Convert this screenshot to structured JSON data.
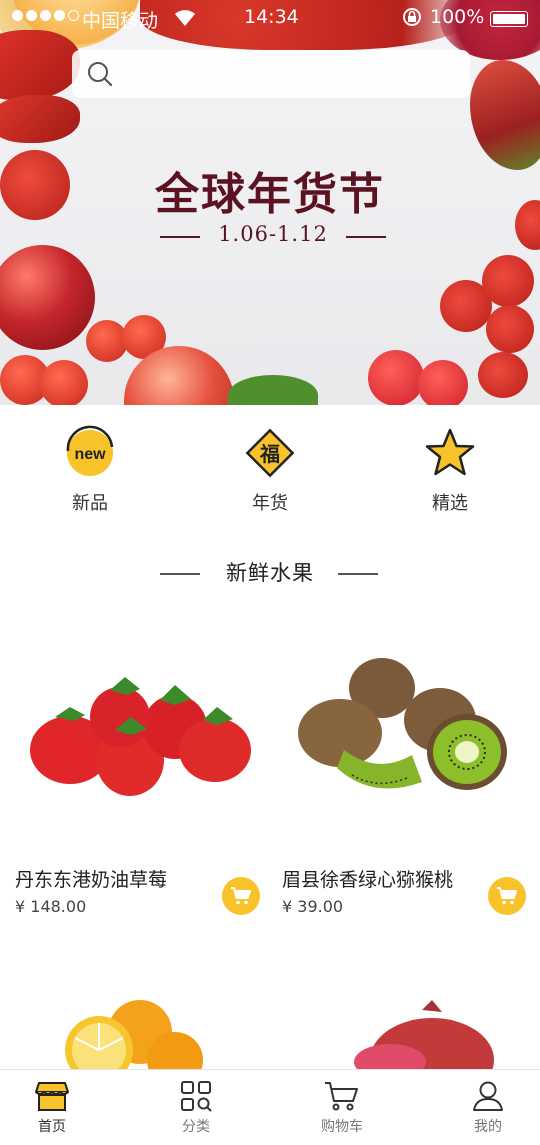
{
  "status_bar": {
    "carrier": "中国移动",
    "time": "14:34",
    "battery": "100%"
  },
  "search": {
    "placeholder": ""
  },
  "banner": {
    "title": "全球年货节",
    "date_range": "1.06-1.12"
  },
  "categories": [
    {
      "label": "新品",
      "icon": "new-badge-icon",
      "badge_text": "new"
    },
    {
      "label": "年货",
      "icon": "fu-diamond-icon",
      "badge_text": "福"
    },
    {
      "label": "精选",
      "icon": "star-icon"
    }
  ],
  "section": {
    "title": "新鲜水果"
  },
  "products": [
    {
      "name": "丹东东港奶油草莓",
      "price": "¥  148.00",
      "image": "strawberries"
    },
    {
      "name": "眉县徐香绿心猕猴桃",
      "price": "¥  39.00",
      "image": "kiwifruit"
    },
    {
      "name": "",
      "price": "",
      "image": "oranges"
    },
    {
      "name": "",
      "price": "",
      "image": "pomegranate"
    }
  ],
  "tabbar": {
    "items": [
      {
        "label": "首页",
        "icon": "shop-icon",
        "active": true
      },
      {
        "label": "分类",
        "icon": "grid-search-icon",
        "active": false
      },
      {
        "label": "购物车",
        "icon": "cart-icon",
        "active": false
      },
      {
        "label": "我的",
        "icon": "user-icon",
        "active": false
      }
    ]
  },
  "colors": {
    "accent": "#f8c32a",
    "banner_title": "#5b1322",
    "text_primary": "#222222"
  }
}
